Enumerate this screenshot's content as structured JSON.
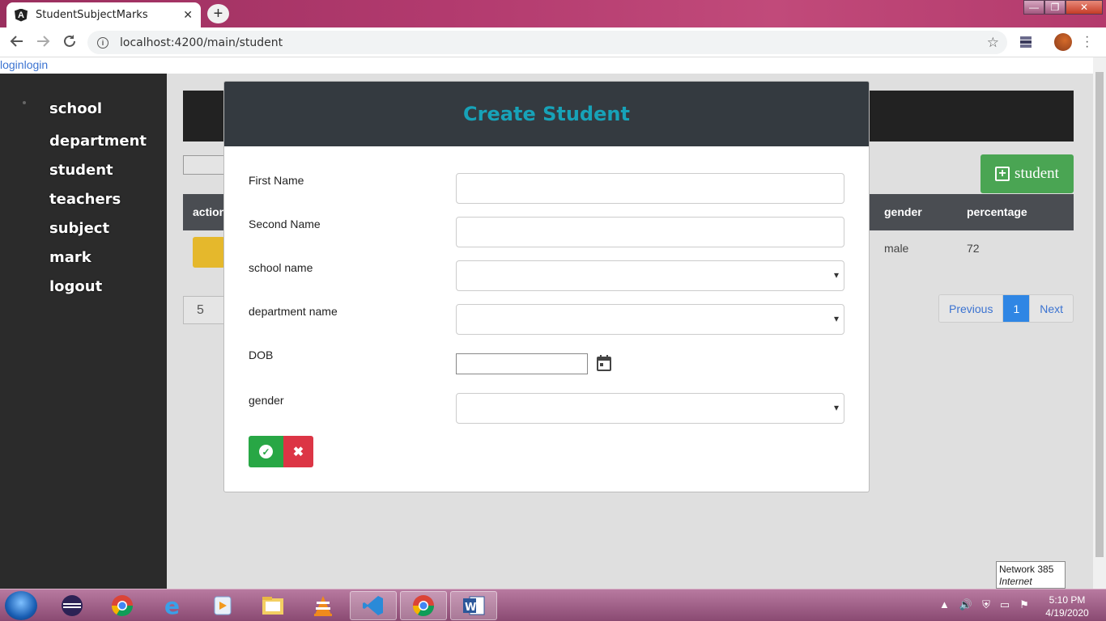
{
  "browser": {
    "tab_title": "StudentSubjectMarks",
    "tab_close": "✕",
    "new_tab": "+",
    "url": "localhost:4200/main/student",
    "window_buttons": [
      "—",
      "❐",
      "✕"
    ]
  },
  "page": {
    "login_link": "loginlogin",
    "sidebar": {
      "items": [
        "school",
        "department",
        "student",
        "teachers",
        "subject",
        "mark",
        "logout"
      ]
    },
    "add_button_label": "student",
    "table": {
      "headers": {
        "action": "action",
        "gender": "gender",
        "percentage": "percentage"
      },
      "rows": [
        {
          "gender": "male",
          "percentage": "72"
        }
      ]
    },
    "page_size": "5",
    "pager": {
      "previous": "Previous",
      "current": "1",
      "next": "Next"
    }
  },
  "modal": {
    "title": "Create Student",
    "fields": {
      "first_name": {
        "label": "First Name",
        "value": ""
      },
      "second_name": {
        "label": "Second Name",
        "value": ""
      },
      "school_name": {
        "label": "school name",
        "value": ""
      },
      "department_name": {
        "label": "department name",
        "value": ""
      },
      "dob": {
        "label": "DOB",
        "value": ""
      },
      "gender": {
        "label": "gender",
        "value": ""
      }
    },
    "confirm_icon": "check-circle-icon",
    "cancel_icon": "close-icon"
  },
  "tooltip": {
    "line1": "Network  385",
    "line2": "Internet access"
  },
  "taskbar": {
    "time": "5:10 PM",
    "date": "4/19/2020"
  },
  "colors": {
    "modal_header_bg": "#343a40",
    "modal_title": "#17a2b8",
    "success": "#28a745",
    "danger": "#dc3545",
    "add_button": "#4aa553",
    "edit_button": "#e5b82c",
    "pager_active": "#2f86e4"
  }
}
